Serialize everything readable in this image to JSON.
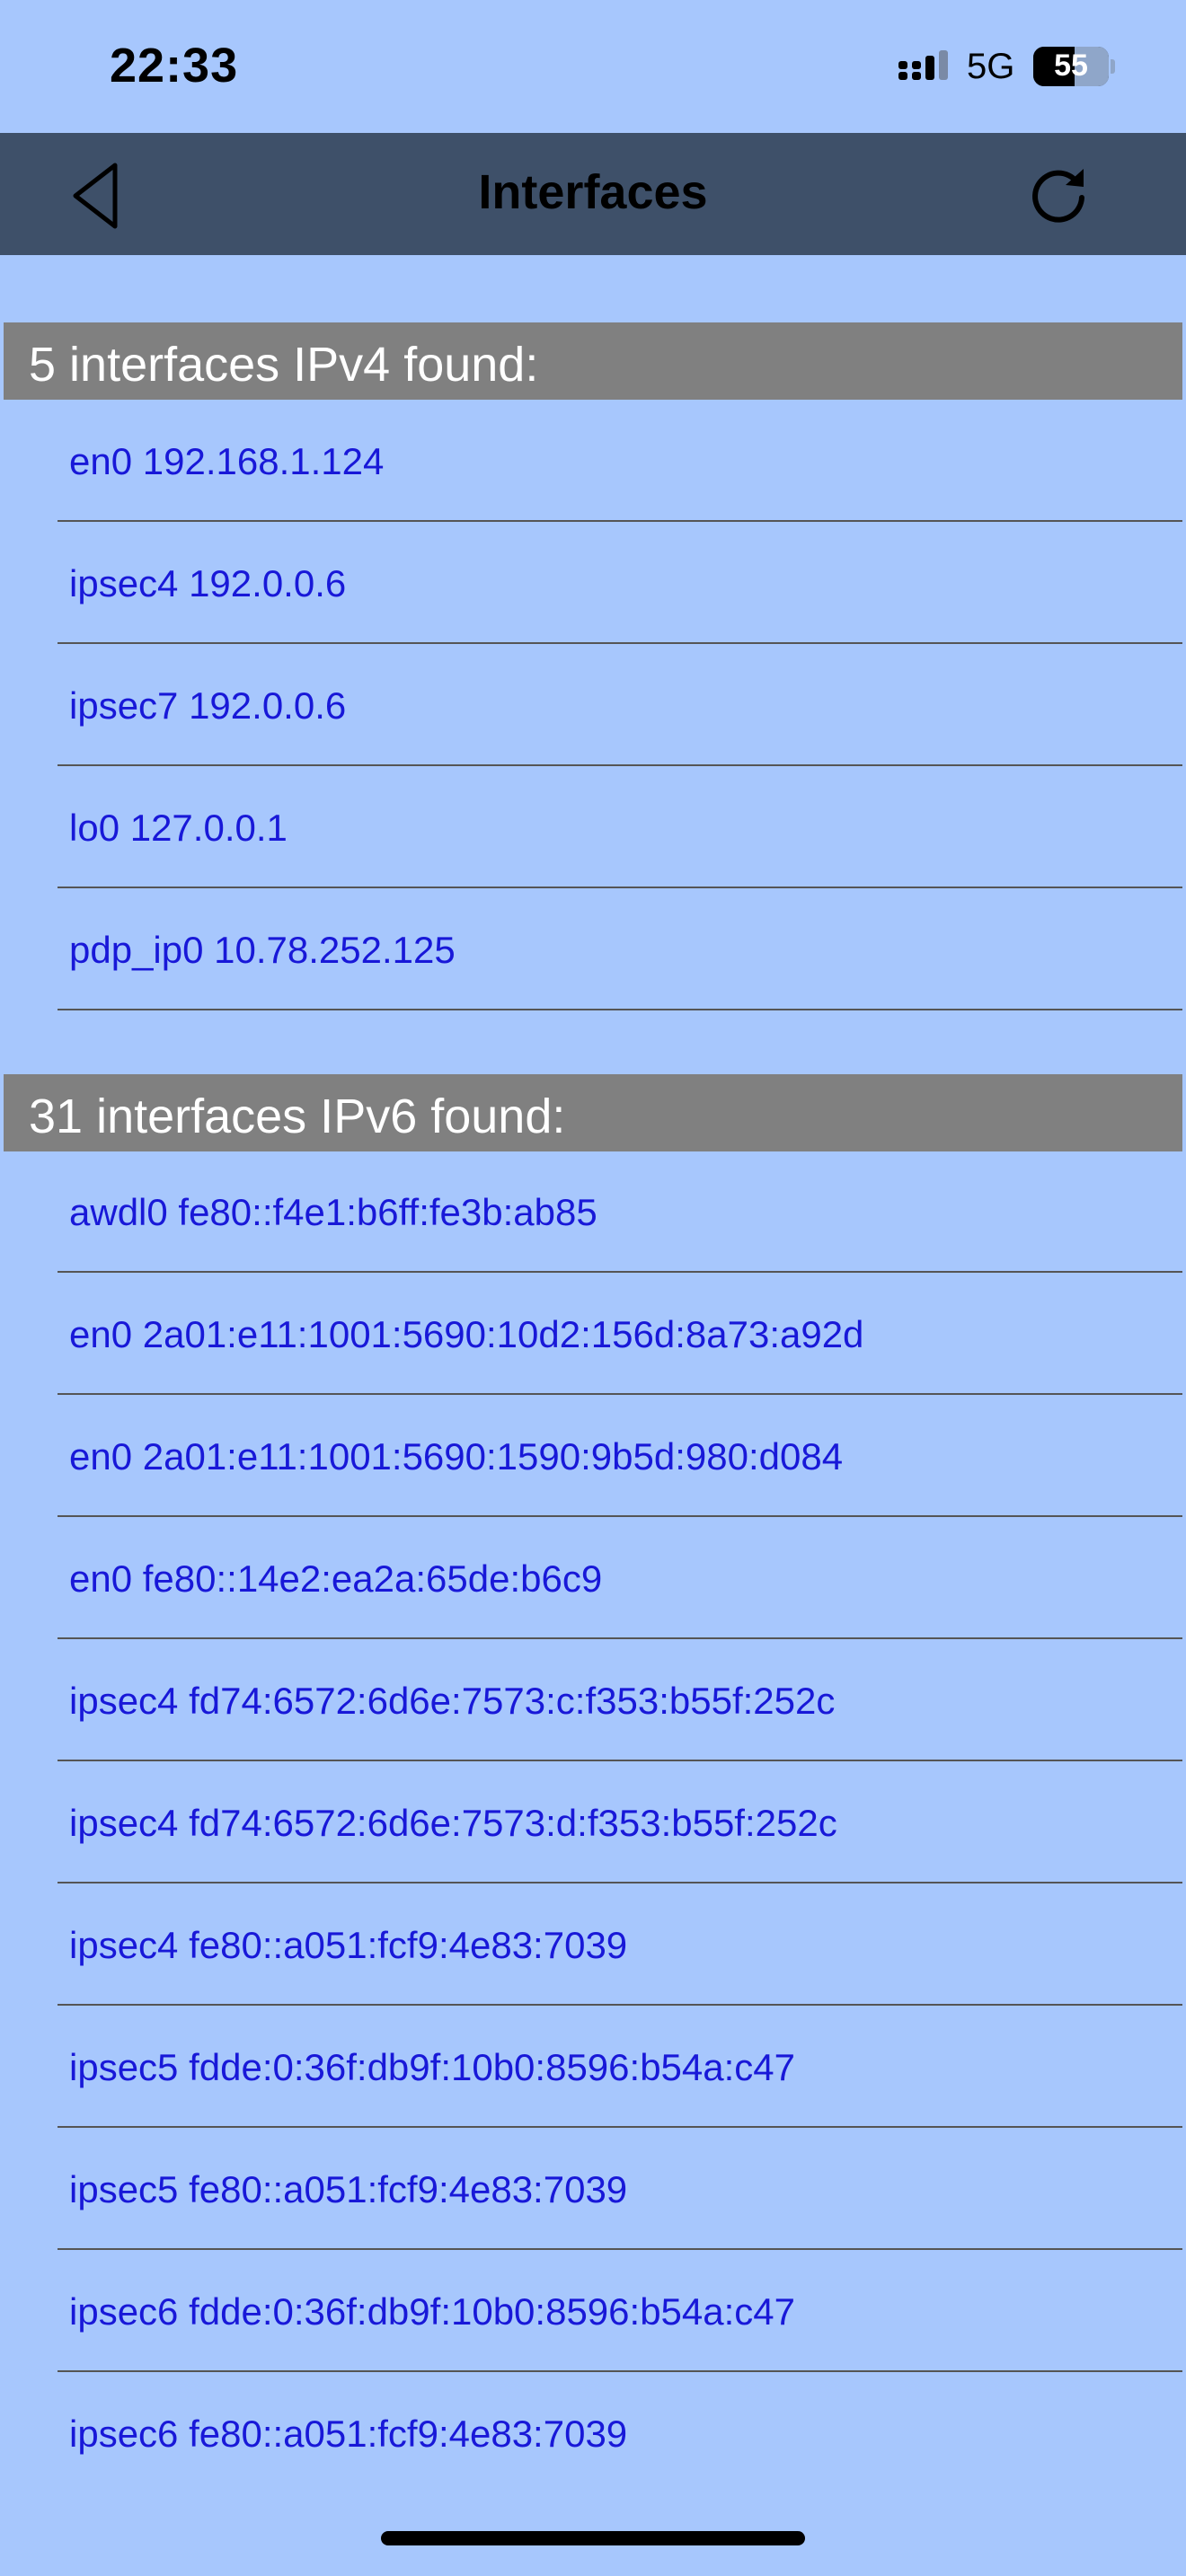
{
  "status_bar": {
    "time": "22:33",
    "network": "5G",
    "battery_level": "55",
    "signal_icon": "cellular-signal-icon"
  },
  "navbar": {
    "title": "Interfaces",
    "back_icon": "back-triangle-icon",
    "refresh_icon": "refresh-icon",
    "background_color": "#3e5069"
  },
  "colors": {
    "page_background": "#a7c7fd",
    "section_header_background": "#808080",
    "row_text": "#1818d8"
  },
  "ipv4": {
    "header": "5 interfaces IPv4 found:",
    "items": [
      "en0 192.168.1.124",
      "ipsec4 192.0.0.6",
      "ipsec7 192.0.0.6",
      "lo0 127.0.0.1",
      "pdp_ip0 10.78.252.125"
    ]
  },
  "ipv6": {
    "header": "31 interfaces IPv6 found:",
    "items": [
      "awdl0 fe80::f4e1:b6ff:fe3b:ab85",
      "en0 2a01:e11:1001:5690:10d2:156d:8a73:a92d",
      "en0 2a01:e11:1001:5690:1590:9b5d:980:d084",
      "en0 fe80::14e2:ea2a:65de:b6c9",
      "ipsec4 fd74:6572:6d6e:7573:c:f353:b55f:252c",
      "ipsec4 fd74:6572:6d6e:7573:d:f353:b55f:252c",
      "ipsec4 fe80::a051:fcf9:4e83:7039",
      "ipsec5 fdde:0:36f:db9f:10b0:8596:b54a:c47",
      "ipsec5 fe80::a051:fcf9:4e83:7039",
      "ipsec6 fdde:0:36f:db9f:10b0:8596:b54a:c47",
      "ipsec6 fe80::a051:fcf9:4e83:7039"
    ]
  }
}
